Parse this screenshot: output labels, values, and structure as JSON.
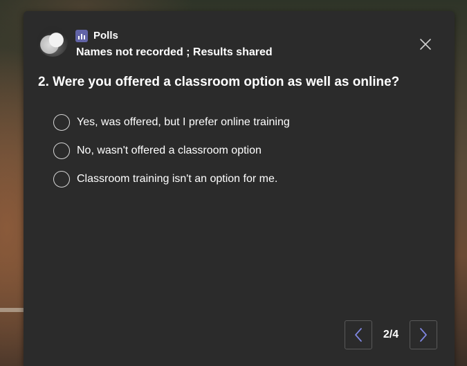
{
  "poll": {
    "app_name": "Polls",
    "subtitle": "Names not recorded ; Results shared",
    "question": "2.  Were you offered a classroom option as well as online?",
    "options": [
      {
        "label": "Yes, was offered, but I prefer online training",
        "selected": false
      },
      {
        "label": "No, wasn't offered a classroom option",
        "selected": false
      },
      {
        "label": "Classroom training isn't an option for me.",
        "selected": false
      }
    ],
    "pagination": {
      "indicator": "2/4"
    }
  },
  "icons": {
    "app": "polls-icon",
    "close": "close-icon",
    "prev": "chevron-left-icon",
    "next": "chevron-right-icon"
  },
  "colors": {
    "card_background": "#2b2b2b",
    "accent": "#6264a7",
    "text": "#ffffff",
    "radio_border": "#d6d6d6"
  }
}
